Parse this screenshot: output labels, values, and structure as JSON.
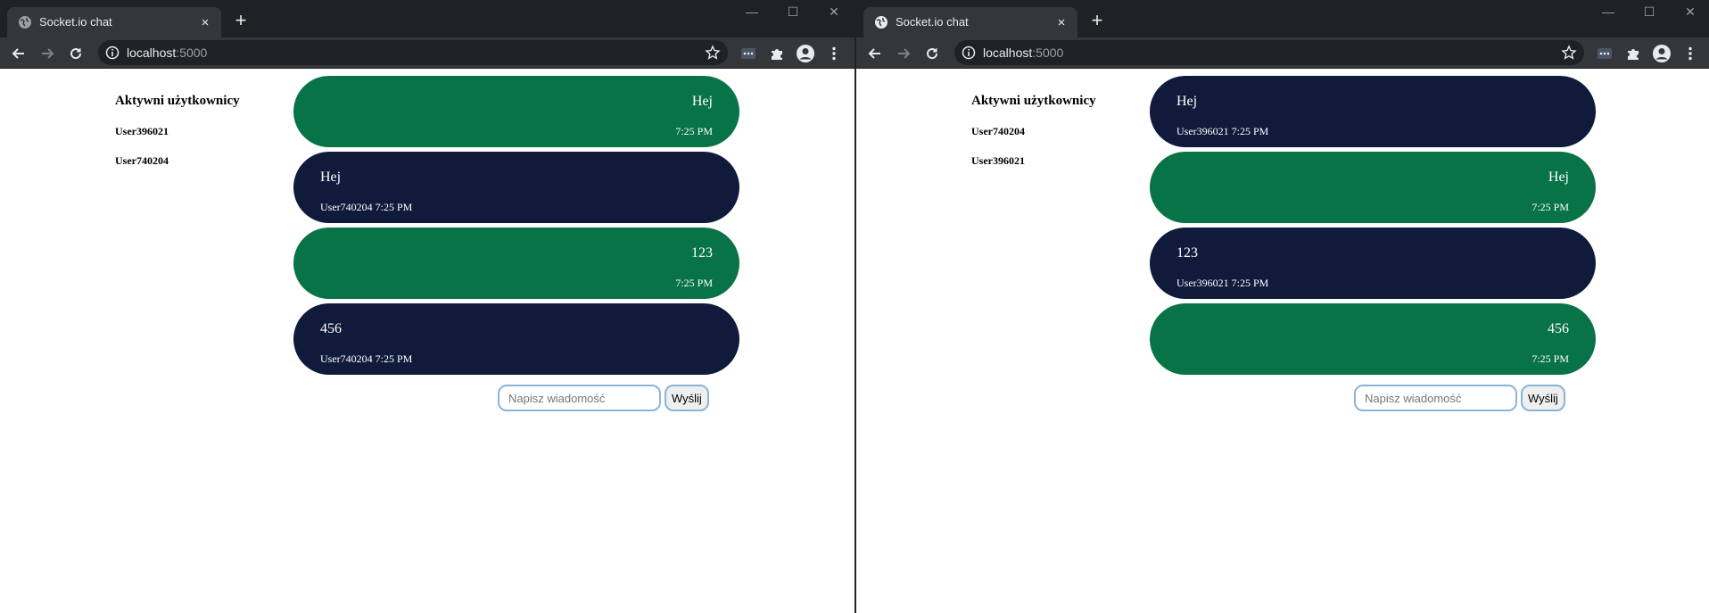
{
  "windows": [
    {
      "tab": {
        "title": "Socket.io chat",
        "close": "×"
      },
      "new_tab": "+",
      "controls": {
        "minimize": "—",
        "maximize": "☐",
        "close": "✕"
      },
      "url": {
        "host": "localhost",
        "port": ":5000"
      },
      "users": {
        "title": "Aktywni użytkownicy",
        "list": [
          "User396021",
          "User740204"
        ]
      },
      "messages": [
        {
          "side": "own",
          "text": "Hej",
          "meta": "7:25 PM"
        },
        {
          "side": "other",
          "text": "Hej",
          "meta": "User740204 7:25 PM"
        },
        {
          "side": "own",
          "text": "123",
          "meta": "7:25 PM"
        },
        {
          "side": "other",
          "text": "456",
          "meta": "User740204 7:25 PM"
        }
      ],
      "composer": {
        "placeholder": "Napisz wiadomość",
        "send_label": "Wyślij"
      }
    },
    {
      "tab": {
        "title": "Socket.io chat",
        "close": "×"
      },
      "new_tab": "+",
      "controls": {
        "minimize": "—",
        "maximize": "☐",
        "close": "✕"
      },
      "url": {
        "host": "localhost",
        "port": ":5000"
      },
      "users": {
        "title": "Aktywni użytkownicy",
        "list": [
          "User740204",
          "User396021"
        ]
      },
      "messages": [
        {
          "side": "other",
          "text": "Hej",
          "meta": "User396021 7:25 PM"
        },
        {
          "side": "own",
          "text": "Hej",
          "meta": "7:25 PM"
        },
        {
          "side": "other",
          "text": "123",
          "meta": "User396021 7:25 PM"
        },
        {
          "side": "own",
          "text": "456",
          "meta": "7:25 PM"
        }
      ],
      "composer": {
        "placeholder": "Napisz wiadomość",
        "send_label": "Wyślij"
      }
    }
  ],
  "colors": {
    "own_bubble": "#077346",
    "other_bubble": "#101b3c",
    "chrome_dark": "#202124",
    "chrome_tab": "#35363a",
    "input_border": "#8ab4d8"
  },
  "icons": [
    "globe-icon",
    "back-arrow-icon",
    "forward-arrow-icon",
    "reload-icon",
    "info-icon",
    "star-icon",
    "extension-menu-icon",
    "puzzle-icon",
    "profile-icon",
    "more-vert-icon"
  ]
}
